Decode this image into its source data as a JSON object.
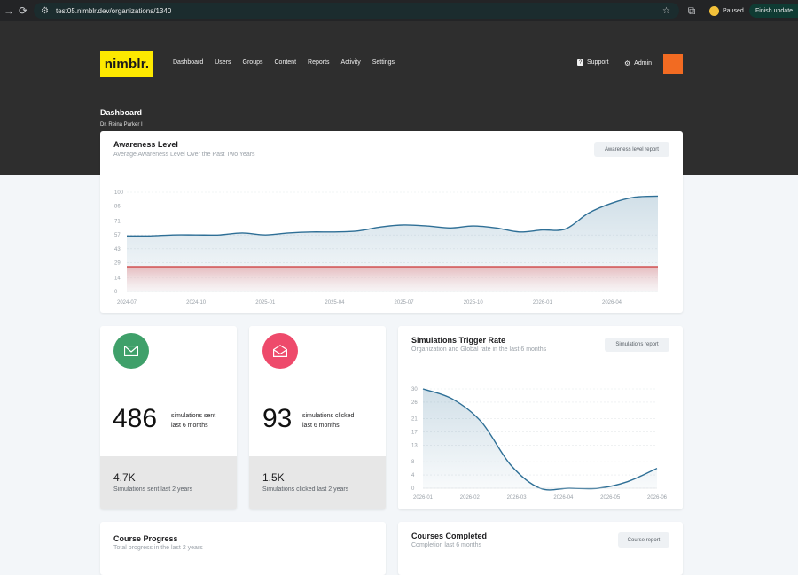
{
  "browser": {
    "url": "test05.nimblr.dev/organizations/1340",
    "paused_label": "Paused",
    "update_label": "Finish update"
  },
  "header": {
    "logo_text": "nimblr.",
    "nav": [
      "Dashboard",
      "Users",
      "Groups",
      "Content",
      "Reports",
      "Activity",
      "Settings"
    ],
    "support_label": "Support",
    "admin_label": "Admin",
    "page_title": "Dashboard",
    "page_subtitle": "Dr. Reina Parker I"
  },
  "awareness": {
    "title": "Awareness Level",
    "subtitle": "Average Awareness Level Over the Past Two Years",
    "report_button": "Awareness level report"
  },
  "sent_card": {
    "count": "486",
    "label_line1": "simulations sent",
    "label_line2": "last 6 months",
    "foot_count": "4.7K",
    "foot_label": "Simulations sent last 2 years"
  },
  "clicked_card": {
    "count": "93",
    "label_line1": "simulations clicked",
    "label_line2": "last 6 months",
    "foot_count": "1.5K",
    "foot_label": "Simulations clicked last 2 years"
  },
  "trigger": {
    "title": "Simulations Trigger Rate",
    "subtitle": "Organization and Global rate in the last 6 months",
    "report_button": "Simulations report"
  },
  "course_progress": {
    "title": "Course Progress",
    "subtitle": "Total progress in the last 2 years"
  },
  "courses_completed": {
    "title": "Courses Completed",
    "subtitle": "Completion last 6 months",
    "report_button": "Course report"
  },
  "colors": {
    "accent_yellow": "#fde900",
    "header_dark": "#2e2e2e",
    "avatar_orange": "#f26b22",
    "sent_green": "#3fa06a",
    "clicked_red": "#ee4a6b",
    "line_blue": "#2e6f96",
    "threshold_red": "#d9322f"
  },
  "chart_data": [
    {
      "type": "area",
      "title": "",
      "ylim": [
        0,
        100
      ],
      "yticks": [
        0,
        14,
        29,
        43,
        57,
        71,
        86,
        100
      ],
      "xticks": [
        "2024-07",
        "2024-10",
        "2025-01",
        "2025-04",
        "2025-07",
        "2025-10",
        "2026-01",
        "2026-04"
      ],
      "grid": true,
      "threshold": 25,
      "x": [
        "2024-07",
        "2024-08",
        "2024-09",
        "2024-10",
        "2024-11",
        "2024-12",
        "2025-01",
        "2025-02",
        "2025-03",
        "2025-04",
        "2025-05",
        "2025-06",
        "2025-07",
        "2025-08",
        "2025-09",
        "2025-10",
        "2025-11",
        "2025-12",
        "2026-01",
        "2026-02",
        "2026-03",
        "2026-04",
        "2026-05",
        "2026-06"
      ],
      "values": [
        56,
        56,
        57,
        57,
        57,
        59,
        57,
        59,
        60,
        60,
        61,
        65,
        67,
        66,
        64,
        66,
        64,
        60,
        62,
        63,
        79,
        89,
        95,
        96
      ]
    },
    {
      "type": "area",
      "title": "",
      "ylim": [
        0,
        30
      ],
      "yticks": [
        0,
        4,
        8,
        13,
        17,
        21,
        26,
        30
      ],
      "xticks": [
        "2026-01",
        "2026-02",
        "2026-03",
        "2026-04",
        "2026-05",
        "2026-06"
      ],
      "grid": true,
      "x": [
        "2026-01",
        "2026-01b",
        "2026-02",
        "2026-02b",
        "2026-03",
        "2026-04",
        "2026-05",
        "2026-05b",
        "2026-06"
      ],
      "values": [
        30,
        27,
        20,
        7,
        0,
        0,
        0,
        2,
        6
      ]
    }
  ]
}
